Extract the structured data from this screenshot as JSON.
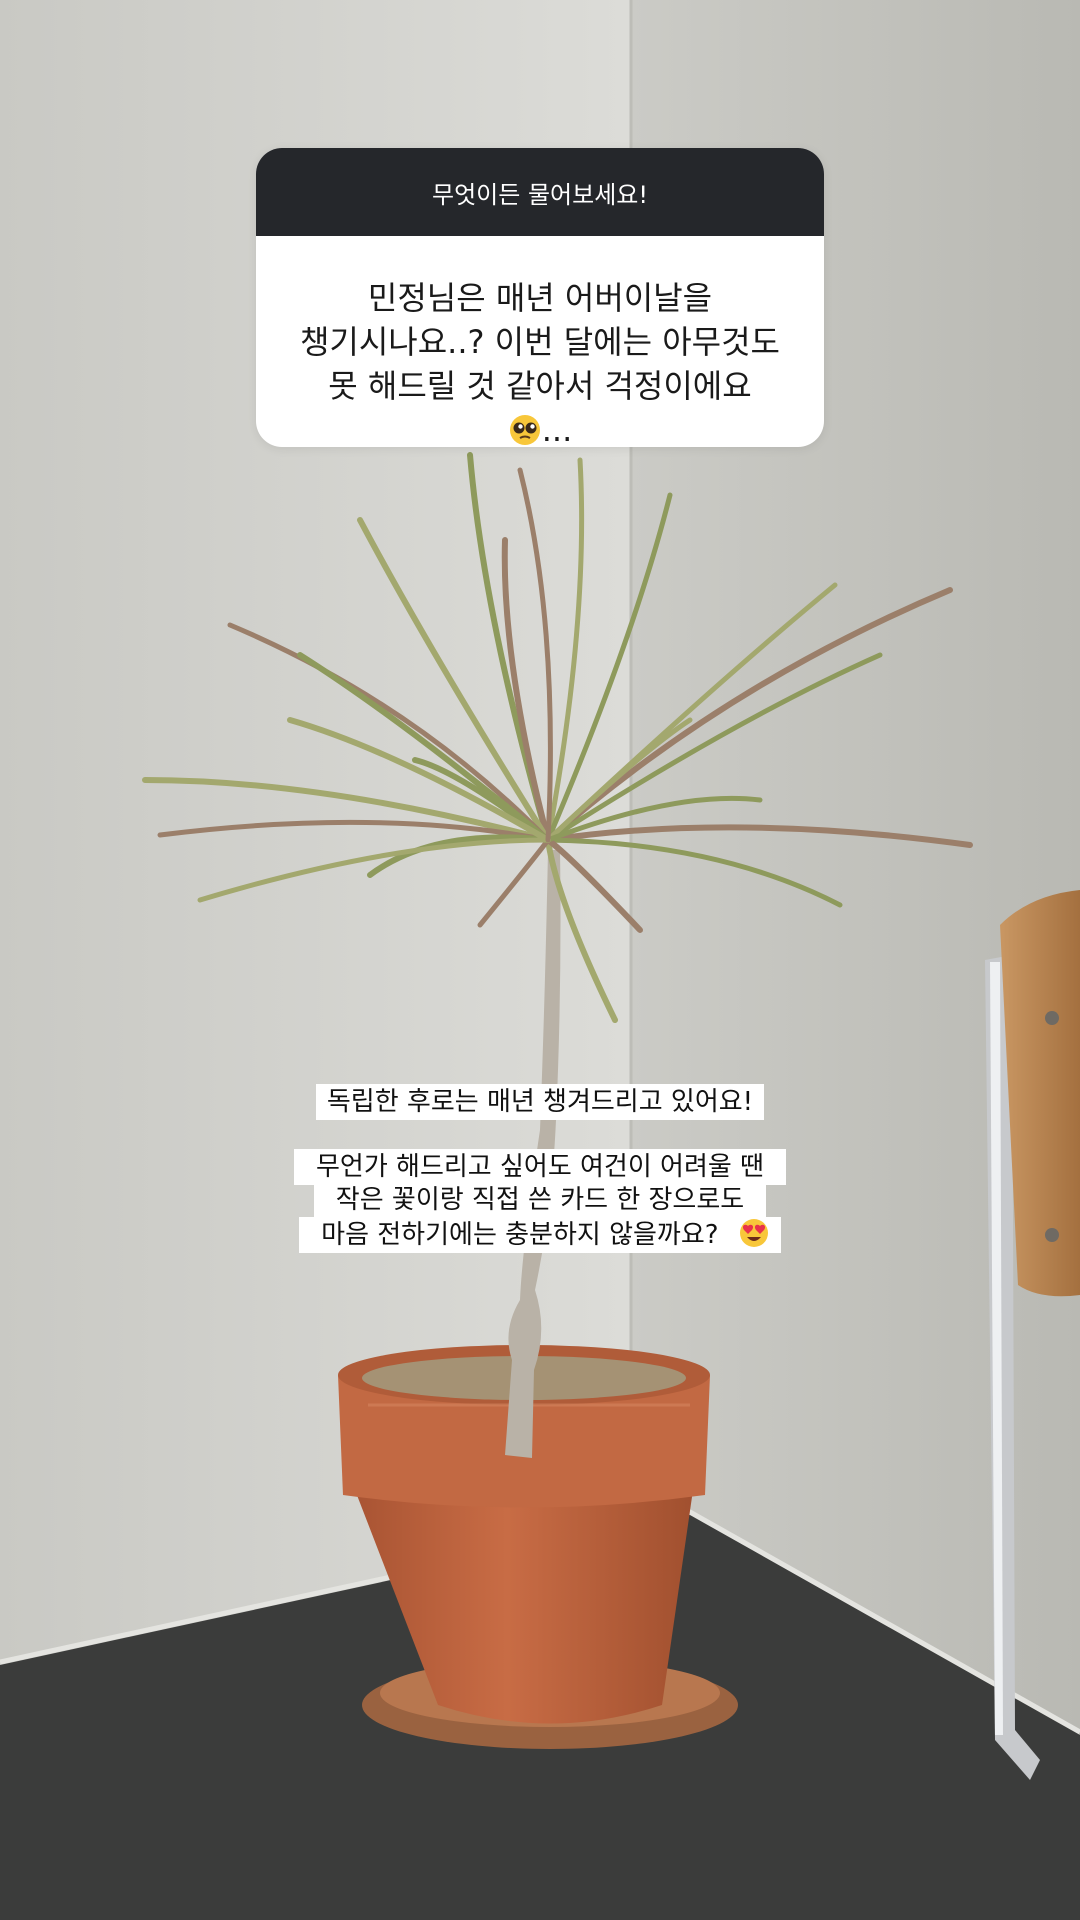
{
  "question_box": {
    "header": "무엇이든 물어보세요!",
    "question_text": "민정님은 매년 어버이날을\n챙기시나요..? 이번 달에는 아무것도\n못 해드릴 것 같아서 걱정이에요",
    "question_emoji": "pleading-face-emoji",
    "question_suffix": "..."
  },
  "answer": {
    "line1": "독립한 후로는 매년 챙겨드리고 있어요!",
    "line2": "무언가 해드리고 싶어도 여건이 어려울 땐\n작은 꽃이랑 직접 쓴 카드 한 장으로도\n마음 전하기에는 충분하지 않을까요?",
    "emoji": "heart-eyes-emoji"
  },
  "colors": {
    "header_bg": "#25272b",
    "card_bg": "#ffffff",
    "pot": "#c0653f",
    "table": "#3a3b3a",
    "wall": "#d3d3cf"
  }
}
